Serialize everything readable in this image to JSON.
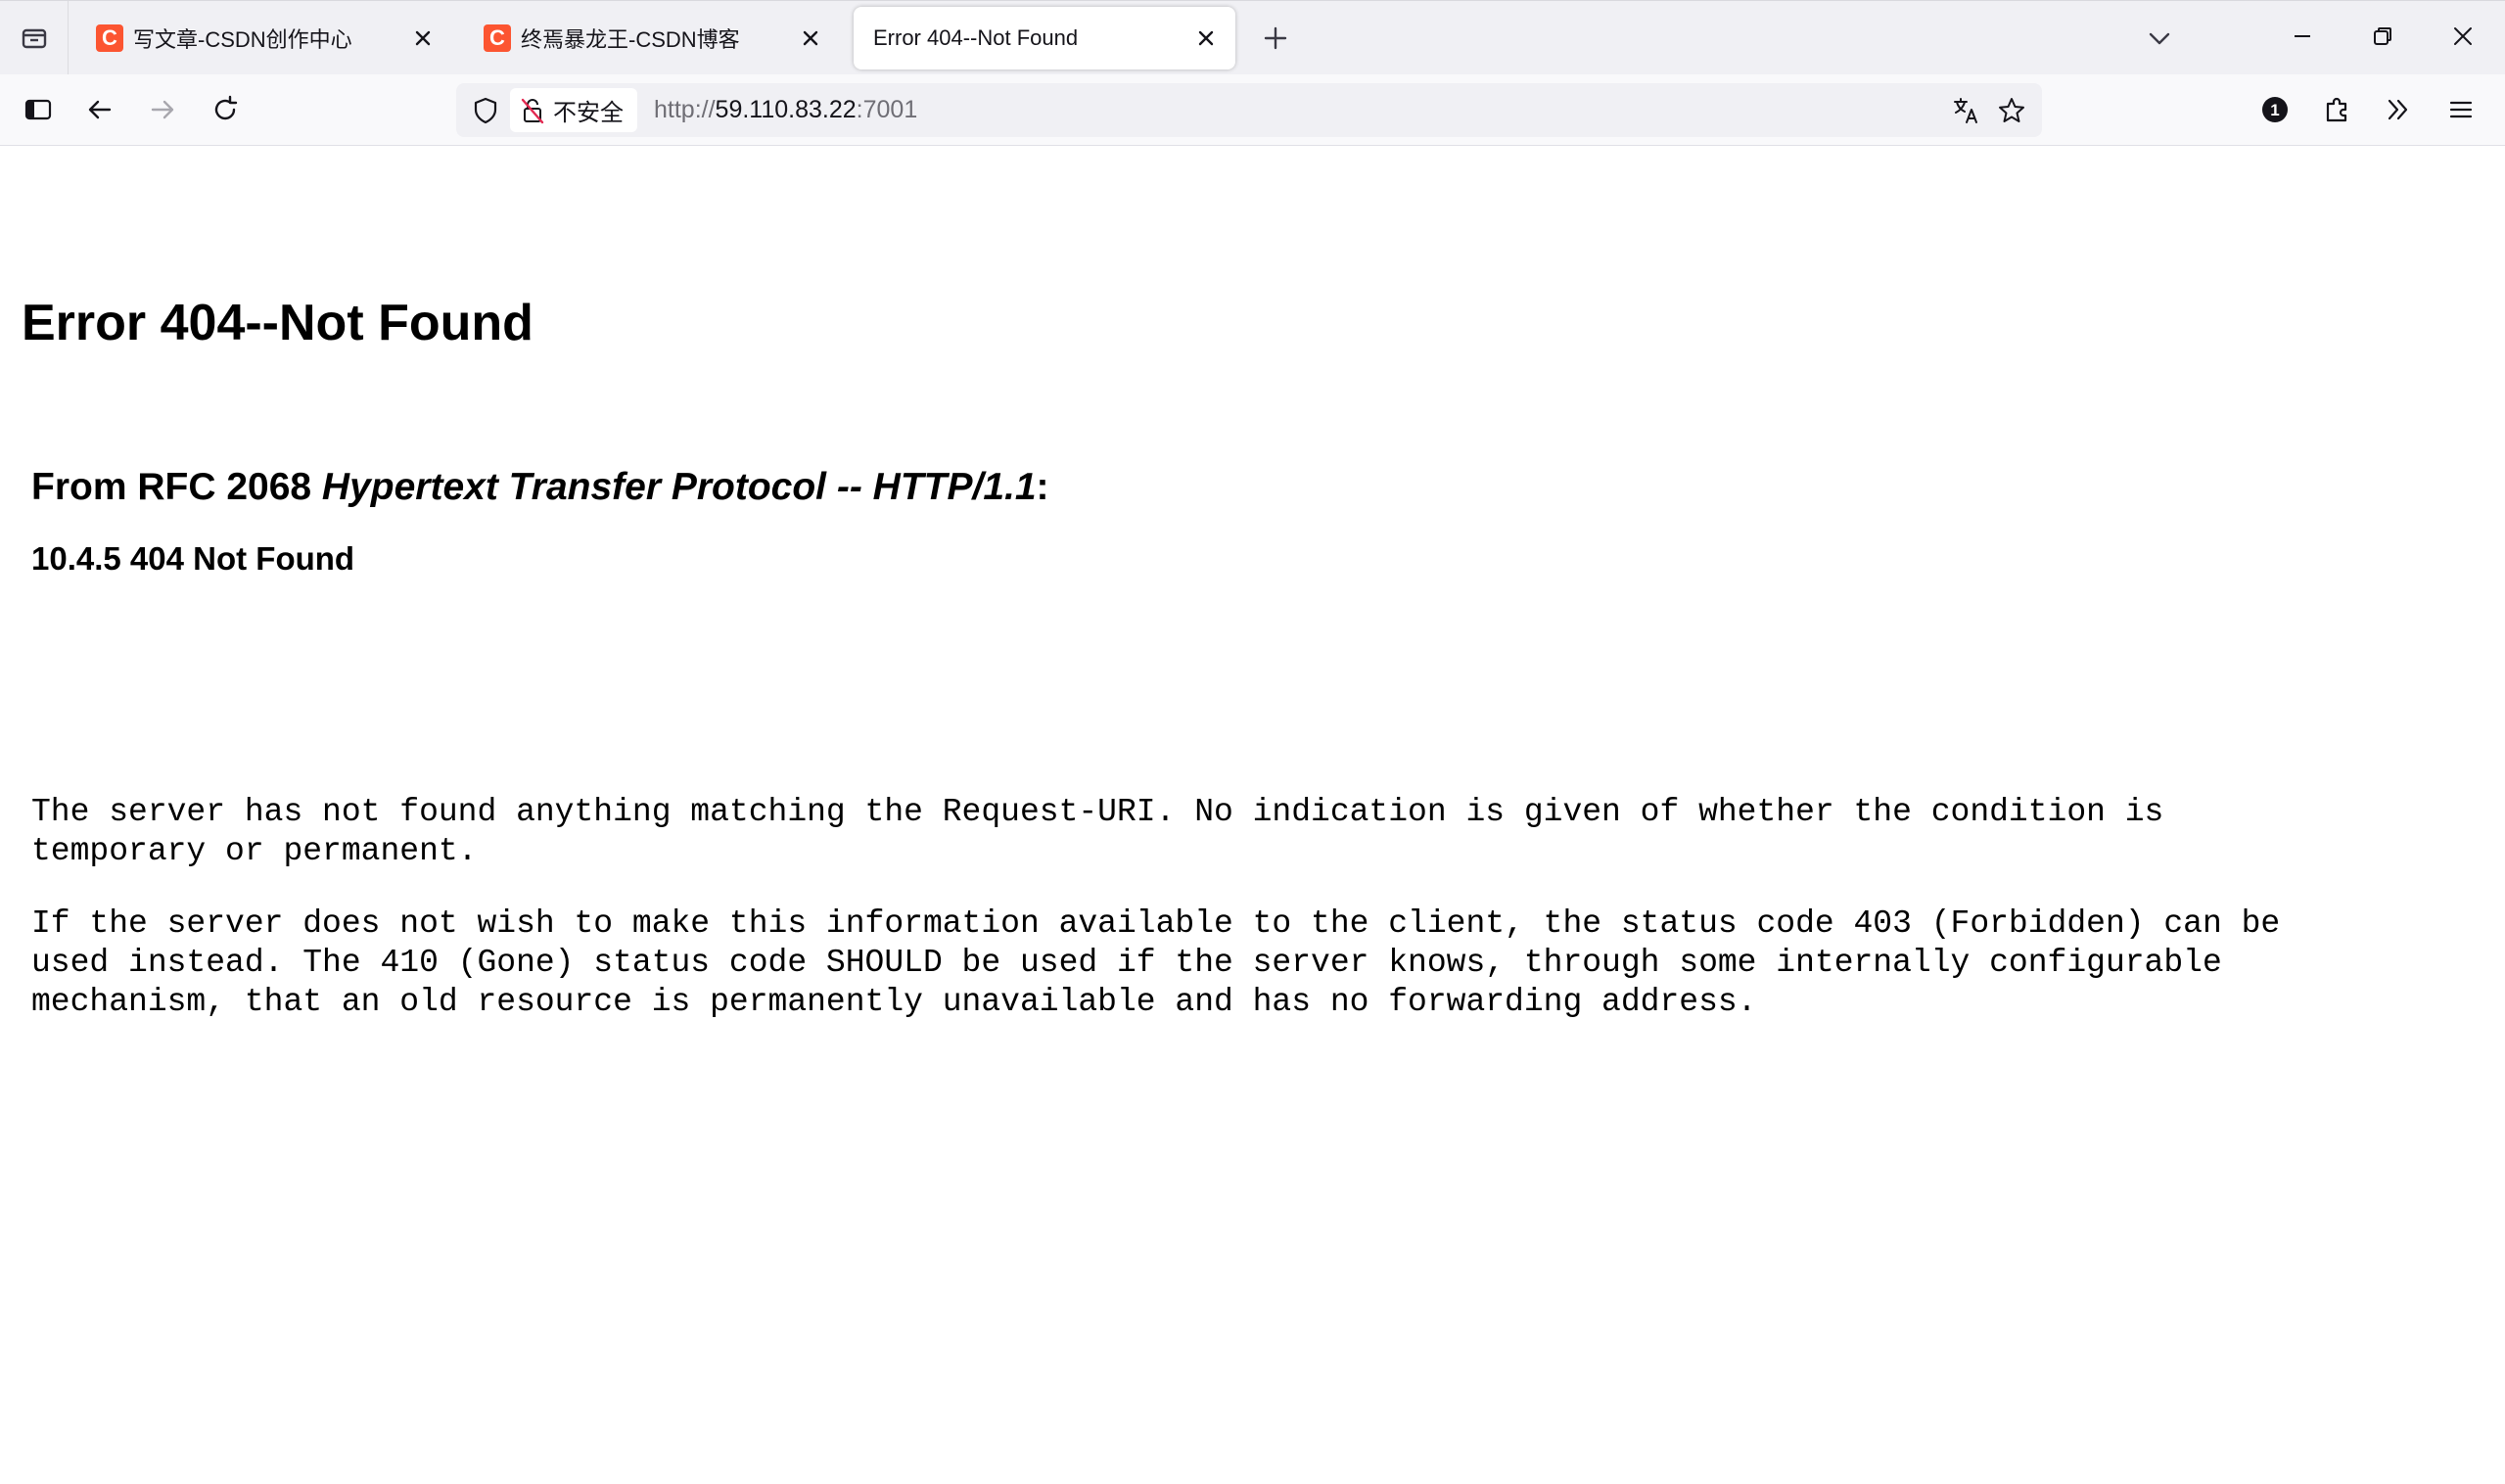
{
  "browser": {
    "tabs": [
      {
        "favicon_letter": "C",
        "title": "写文章-CSDN创作中心",
        "active": false
      },
      {
        "favicon_letter": "C",
        "title": "终焉暴龙王-CSDN博客",
        "active": false
      },
      {
        "favicon_letter": "",
        "title": "Error 404--Not Found",
        "active": true
      }
    ],
    "address_bar": {
      "security_label": "不安全",
      "url_scheme": "http://",
      "url_host": "59.110.83.22",
      "url_port": ":7001"
    },
    "toolbar_badge": "1",
    "colors": {
      "csdn_favicon": "#fc5531",
      "tabstrip_bg": "#f0f0f4",
      "navbar_bg": "#f9f9fb"
    }
  },
  "page": {
    "h1": "Error 404--Not Found",
    "rfc_prefix": "From RFC 2068 ",
    "rfc_title": "Hypertext Transfer Protocol -- HTTP/1.1",
    "rfc_suffix": ":",
    "section": "10.4.5 404 Not Found",
    "paragraph1": "The server has not found anything matching the Request-URI. No indication is given of whether the condition is\ntemporary or permanent.",
    "paragraph2": "If the server does not wish to make this information available to the client, the status code 403 (Forbidden) can be\nused instead. The 410 (Gone) status code SHOULD be used if the server knows, through some internally configurable\nmechanism, that an old resource is permanently unavailable and has no forwarding address."
  }
}
